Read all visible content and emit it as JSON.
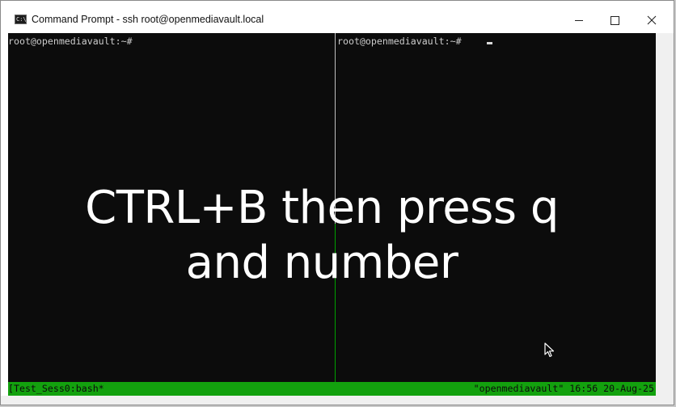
{
  "window": {
    "title": "Command Prompt - ssh  root@openmediavault.local",
    "icon": "console-icon",
    "icon_glyph": "C:\\"
  },
  "terminal": {
    "left_prompt": "root@openmediavault:~#",
    "right_prompt": "root@openmediavault:~#",
    "status_left": "[Test_Sess0:bash*",
    "status_right": "\"openmediavault\" 16:56 20-Aug-25"
  },
  "overlay": {
    "line1": "CTRL+B then press q",
    "line2": "and number"
  },
  "colors": {
    "terminal_bg": "#0c0c0c",
    "status_bar": "#13a10e",
    "active_divider": "#00a000",
    "text": "#cccccc"
  }
}
